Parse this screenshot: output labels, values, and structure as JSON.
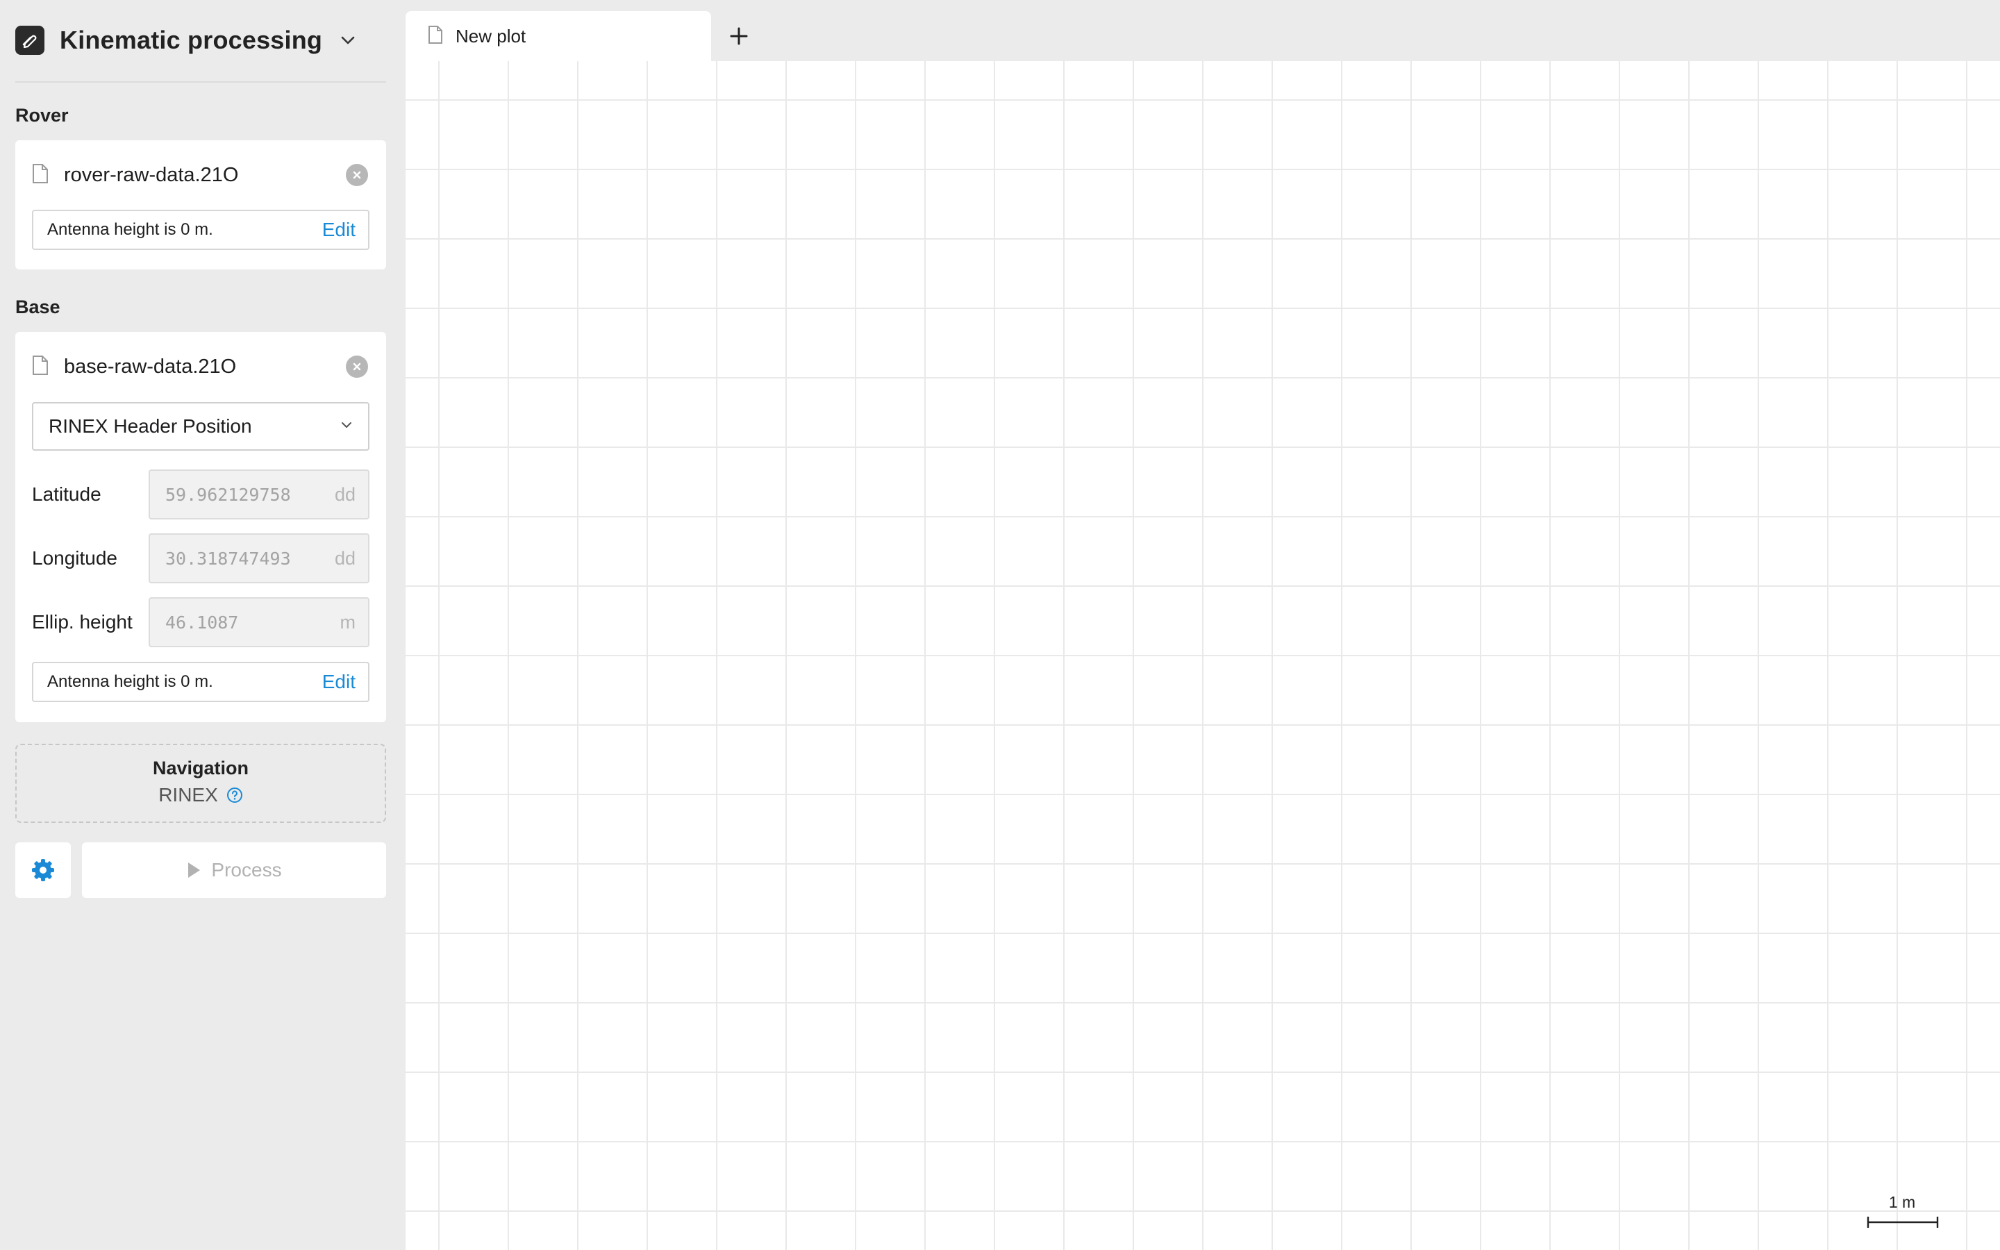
{
  "app": {
    "title": "Kinematic processing",
    "logo_icon": "link-pencil-icon",
    "accent_color": "#1a8ad6"
  },
  "rover": {
    "label": "Rover",
    "file_name": "rover-raw-data.21O",
    "antenna_text": "Antenna height is 0 m.",
    "edit_label": "Edit"
  },
  "base": {
    "label": "Base",
    "file_name": "base-raw-data.21O",
    "position_source": "RINEX Header Position",
    "fields": [
      {
        "label": "Latitude",
        "value": "59.962129758",
        "unit": "dd"
      },
      {
        "label": "Longitude",
        "value": "30.318747493",
        "unit": "dd"
      },
      {
        "label": "Ellip. height",
        "value": "46.1087",
        "unit": "m"
      }
    ],
    "antenna_text": "Antenna height is 0 m.",
    "edit_label": "Edit"
  },
  "navigation": {
    "title": "Navigation",
    "source": "RINEX"
  },
  "actions": {
    "process_label": "Process"
  },
  "tabs": [
    {
      "label": "New plot",
      "active": true
    }
  ],
  "plot": {
    "scale_label": "1 m"
  }
}
